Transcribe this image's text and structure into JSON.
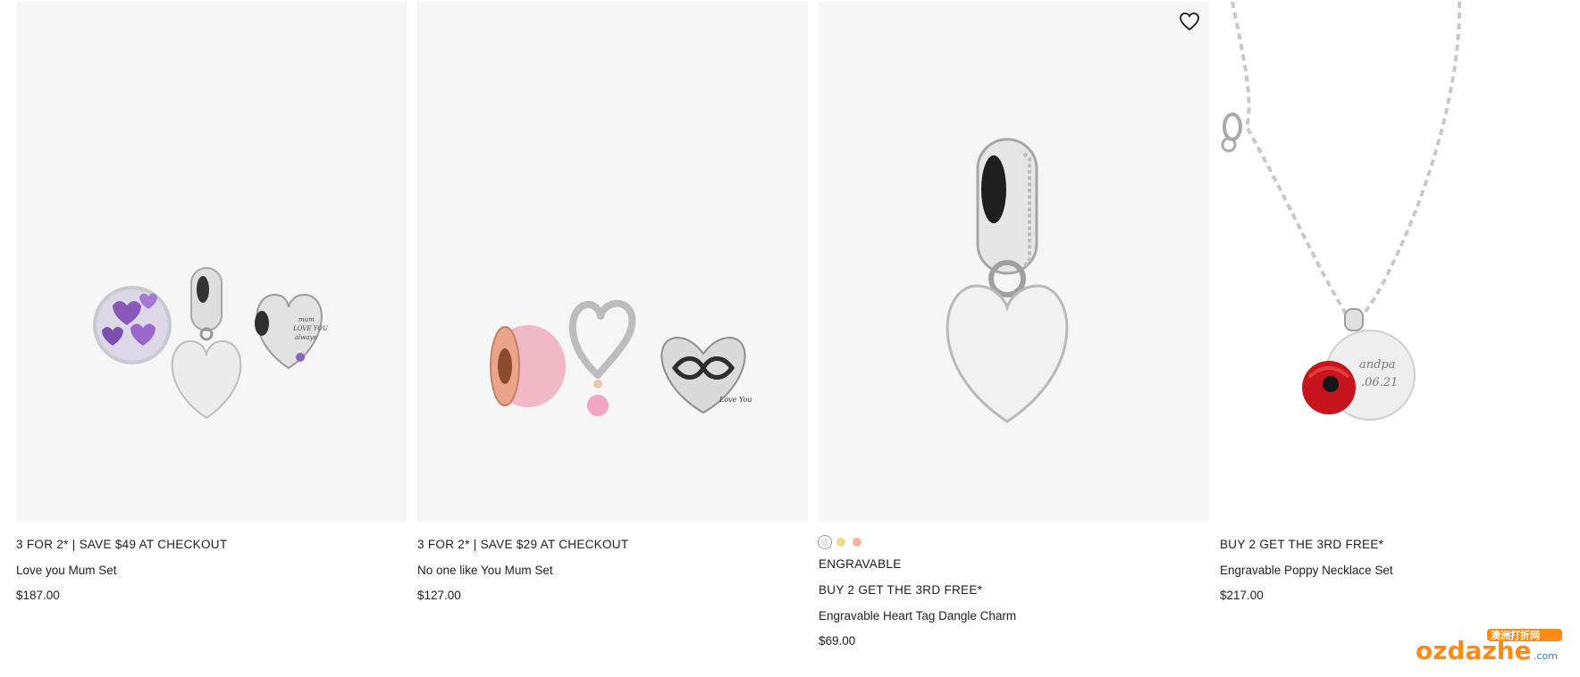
{
  "products": [
    {
      "promo": "3 FOR 2* | SAVE $49 AT CHECKOUT",
      "title": "Love you Mum Set",
      "price": "$187.00",
      "image_icon": "charm-set-image"
    },
    {
      "promo": "3 FOR 2* | SAVE $29 AT CHECKOUT",
      "title": "No one like You Mum Set",
      "price": "$127.00",
      "image_icon": "charm-set-image"
    },
    {
      "tag": "ENGRAVABLE",
      "promo": "BUY 2 GET THE 3RD FREE*",
      "title": "Engravable Heart Tag Dangle Charm",
      "price": "$69.00",
      "swatches": [
        "#e8e8e8",
        "#f3d98a",
        "#f2b79e"
      ],
      "wishlist_icon": "heart-outline-icon"
    },
    {
      "promo": "BUY 2 GET THE 3RD FREE*",
      "title": "Engravable Poppy Necklace Set",
      "price": "$217.00"
    }
  ],
  "watermark": {
    "brand": "ozdazhe",
    "suffix": ".com",
    "chinese": "澳洲打折网"
  }
}
